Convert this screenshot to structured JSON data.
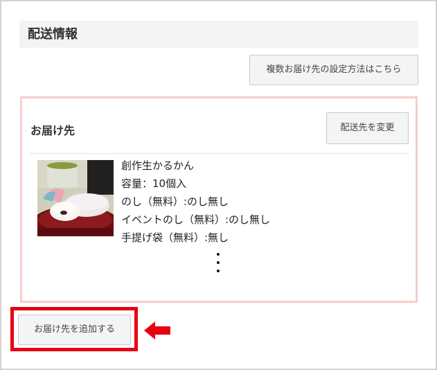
{
  "section": {
    "title": "配送情報"
  },
  "buttons": {
    "multi_destination_help": "複数お届け先の設定方法はこちら",
    "change_destination": "配送先を変更",
    "add_destination": "お届け先を追加する"
  },
  "destination": {
    "title": "お届け先",
    "product": {
      "name": "創作生かるかん",
      "lines": [
        "容量：10個入",
        "のし（無料）:のし無し",
        "イベントのし（無料）:のし無し",
        "手提げ袋（無料）:無し"
      ]
    },
    "continuation": "⋮"
  },
  "colors": {
    "destination_border": "#f8cccc",
    "highlight": "#e60012",
    "button_bg": "#f3f4f6",
    "header_bg": "#f3f3f3"
  },
  "icons": {
    "annotation_arrow": "arrow-left-icon",
    "product_image": "product-photo-karukan"
  }
}
